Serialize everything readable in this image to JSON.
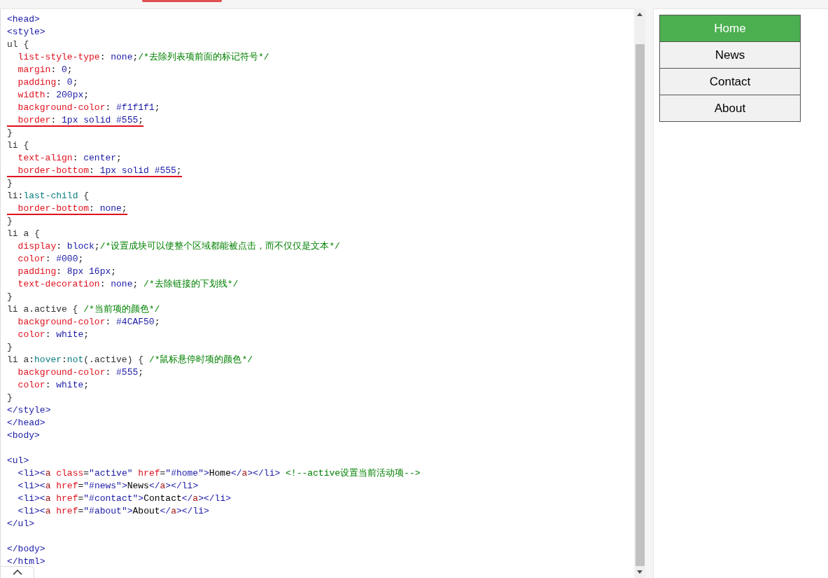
{
  "editor": {
    "blocks": [
      {
        "lines": [
          {
            "text": "<head>",
            "underlined": false
          },
          {
            "text": "<style>",
            "underlined": false
          },
          {
            "text": "ul {",
            "underlined": false
          },
          {
            "text": "  list-style-type: none;/*去除列表项前面的标记符号*/",
            "underlined": false
          },
          {
            "text": "  margin: 0;",
            "underlined": false
          },
          {
            "text": "  padding: 0;",
            "underlined": false
          },
          {
            "text": "  width: 200px;",
            "underlined": false
          },
          {
            "text": "  background-color: #f1f1f1;",
            "underlined": false
          },
          {
            "text": "  border: 1px solid #555;",
            "underlined": true
          },
          {
            "text": "}",
            "underlined": false
          },
          {
            "text": "li {",
            "underlined": false
          },
          {
            "text": "  text-align: center;",
            "underlined": false
          },
          {
            "text": "  border-bottom: 1px solid #555;",
            "underlined": true
          },
          {
            "text": "}",
            "underlined": false
          },
          {
            "text": "li:last-child {",
            "underlined": false
          },
          {
            "text": "  border-bottom: none;",
            "underlined": true
          },
          {
            "text": "}",
            "underlined": false
          },
          {
            "text": "li a {",
            "underlined": false
          },
          {
            "text": "  display: block;/*设置成块可以使整个区域都能被点击，而不仅仅是文本*/",
            "underlined": false
          },
          {
            "text": "  color: #000;",
            "underlined": false
          },
          {
            "text": "  padding: 8px 16px;",
            "underlined": false
          },
          {
            "text": "  text-decoration: none; /*去除链接的下划线*/",
            "underlined": false
          },
          {
            "text": "}",
            "underlined": false
          },
          {
            "text": "li a.active { /*当前项的颜色*/",
            "underlined": false
          },
          {
            "text": "  background-color: #4CAF50;",
            "underlined": false
          },
          {
            "text": "  color: white;",
            "underlined": false
          },
          {
            "text": "}",
            "underlined": false
          },
          {
            "text": "li a:hover:not(.active) { /*鼠标悬停时项的颜色*/",
            "underlined": false
          },
          {
            "text": "  background-color: #555;",
            "underlined": false
          },
          {
            "text": "  color: white;",
            "underlined": false
          },
          {
            "text": "}",
            "underlined": false
          },
          {
            "text": "</style>",
            "underlined": false
          },
          {
            "text": "</head>",
            "underlined": false
          },
          {
            "text": "<body>",
            "underlined": false
          }
        ]
      },
      {
        "lines": [
          {
            "text": "<ul>",
            "underlined": false
          },
          {
            "text": "  <li><a class=\"active\" href=\"#home\">Home</a></li> <!--active设置当前活动项-->",
            "underlined": false
          },
          {
            "text": "  <li><a href=\"#news\">News</a></li>",
            "underlined": false
          },
          {
            "text": "  <li><a href=\"#contact\">Contact</a></li>",
            "underlined": false
          },
          {
            "text": "  <li><a href=\"#about\">About</a></li>",
            "underlined": false
          },
          {
            "text": "</ul>",
            "underlined": false
          }
        ]
      },
      {
        "lines": [
          {
            "text": "</body>",
            "underlined": false
          },
          {
            "text": "</html>",
            "underlined": false
          }
        ]
      }
    ]
  },
  "preview": {
    "nav": [
      {
        "label": "Home",
        "selected": true
      },
      {
        "label": "News",
        "selected": false
      },
      {
        "label": "Contact",
        "selected": false
      },
      {
        "label": "About",
        "selected": false
      }
    ]
  }
}
